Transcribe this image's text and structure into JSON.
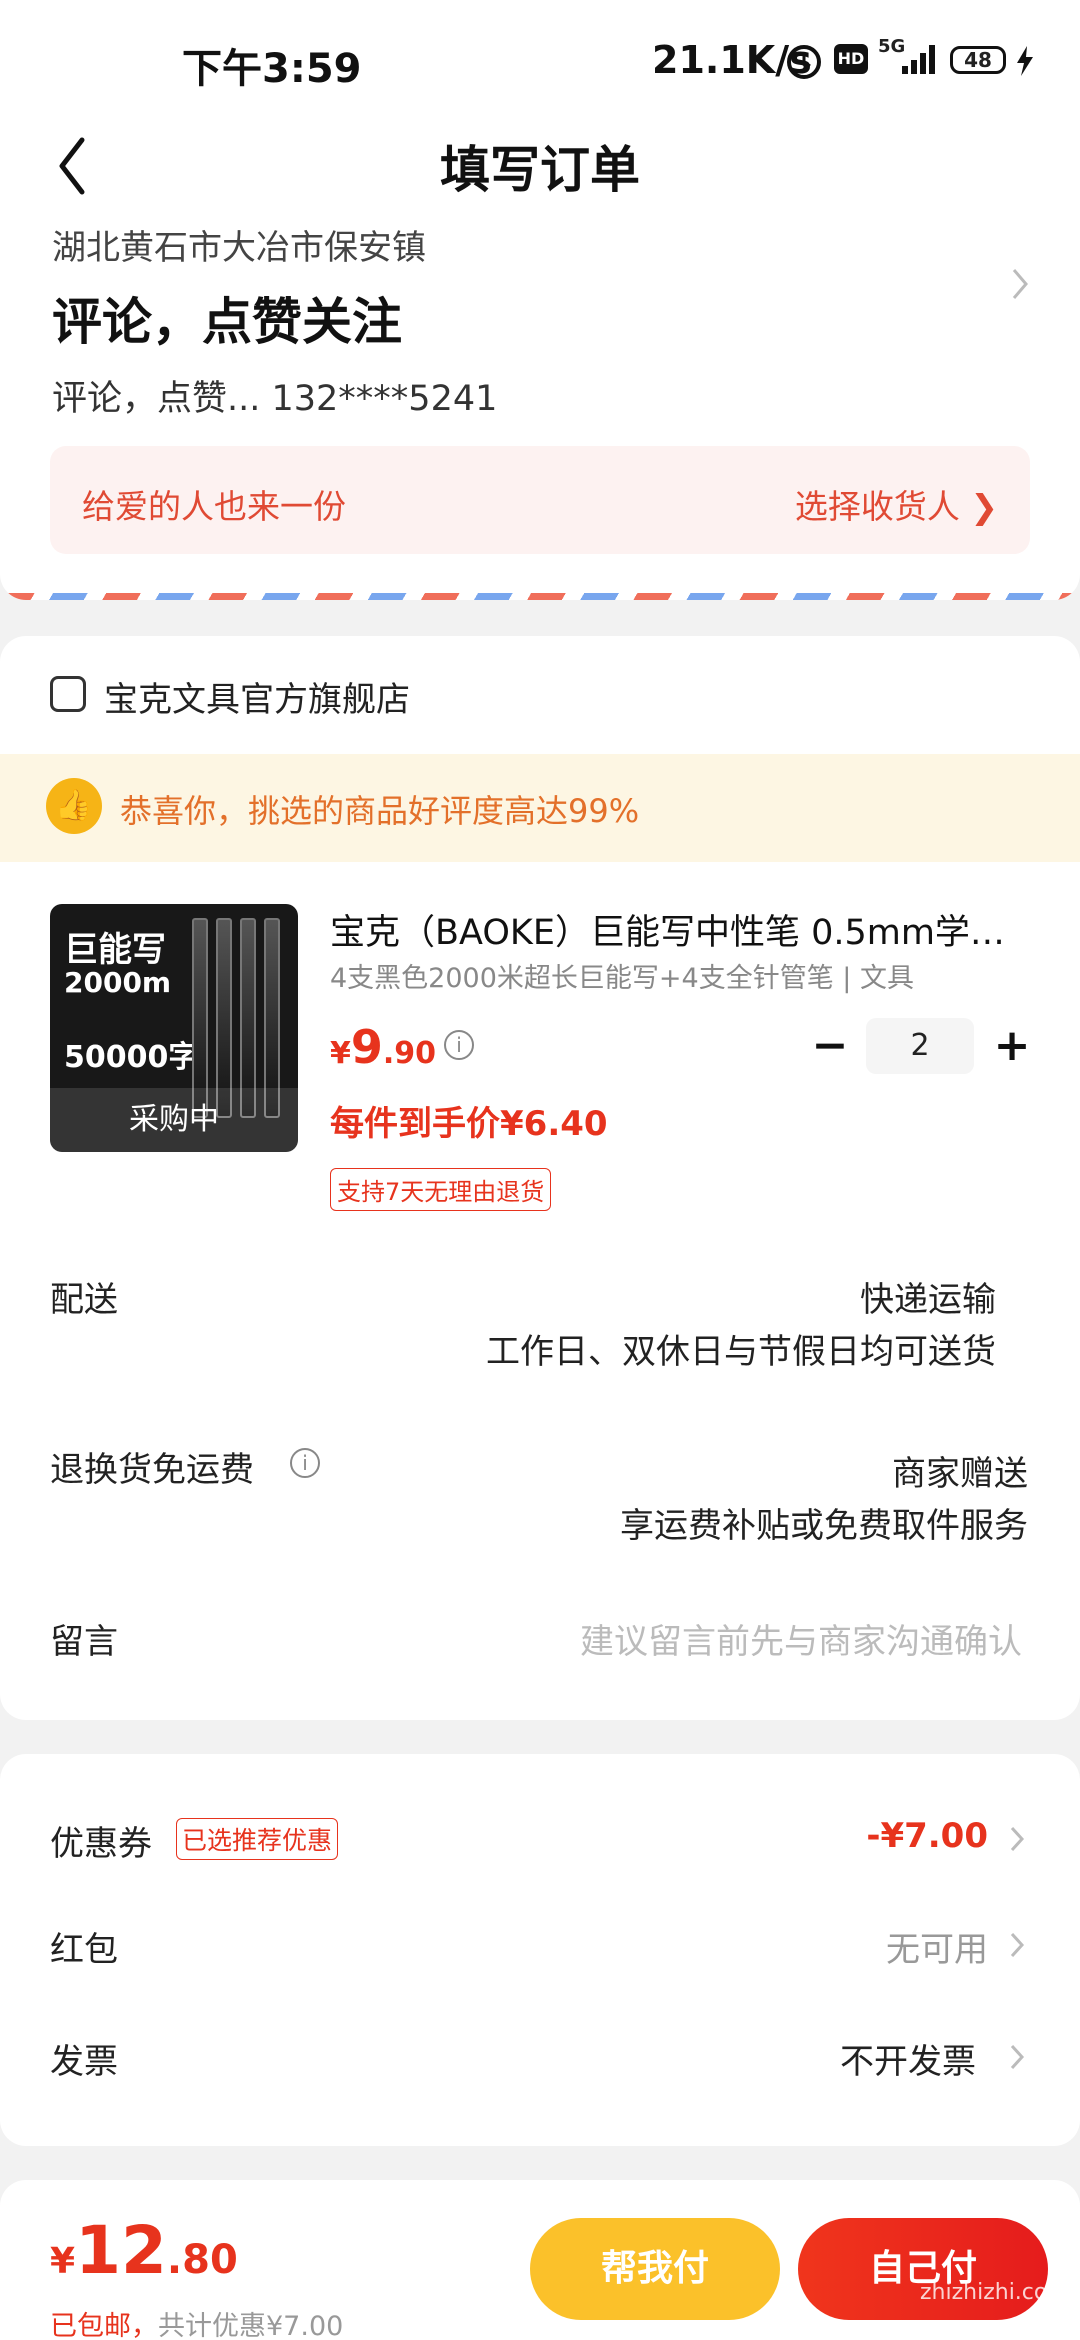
{
  "status_bar": {
    "time": "下午3:59",
    "net_speed": "21.1K/s",
    "hd": "HD",
    "signal": "5G",
    "battery": "48"
  },
  "nav": {
    "title": "填写订单"
  },
  "address": {
    "region": "湖北黄石市大冶市保安镇",
    "name": "评论，点赞关注",
    "contact": "评论，点赞...  132****5241",
    "gift_text": "给爱的人也来一份",
    "gift_action": "选择收货人 ❯"
  },
  "shop": {
    "name": "宝克文具官方旗舰店"
  },
  "praise": {
    "text": "恭喜你，挑选的商品好评度高达99%"
  },
  "product": {
    "image_text_1": "巨能写",
    "image_text_2": "2000m",
    "image_text_3": "50000字",
    "image_badge": "采购中",
    "title": "宝克（BAOKE）巨能写中性笔 0.5mm学…",
    "sku": "4支黑色2000米超长巨能写+4支全针管笔 | 文具",
    "price_currency": "¥",
    "price_int": "9",
    "price_dec": ".90",
    "quantity": "2",
    "unit_price": "每件到手价¥6.40",
    "return_tag": "支持7天无理由退货"
  },
  "delivery": {
    "label": "配送",
    "value": "快递运输",
    "note": "工作日、双休日与节假日均可送货"
  },
  "return_shipping": {
    "label": "退换货免运费",
    "value": "商家赠送",
    "note": "享运费补贴或免费取件服务"
  },
  "message": {
    "label": "留言",
    "placeholder": "建议留言前先与商家沟通确认"
  },
  "summary": {
    "coupon_label": "优惠券",
    "coupon_tag": "已选推荐优惠",
    "coupon_value": "-¥7.00",
    "redpacket_label": "红包",
    "redpacket_value": "无可用",
    "invoice_label": "发票",
    "invoice_value": "不开发票"
  },
  "footer": {
    "total_currency": "¥",
    "total_int": "12",
    "total_dec": ".80",
    "free_shipping": "已包邮，",
    "discount": "共计优惠¥7.00",
    "help_pay": "帮我付",
    "self_pay": "自己付",
    "watermark": "zhizhizhi.com"
  },
  "colors": {
    "accent": "#e7331d",
    "help_button": "#fbc12a",
    "pay_button": "#e51c1c"
  }
}
